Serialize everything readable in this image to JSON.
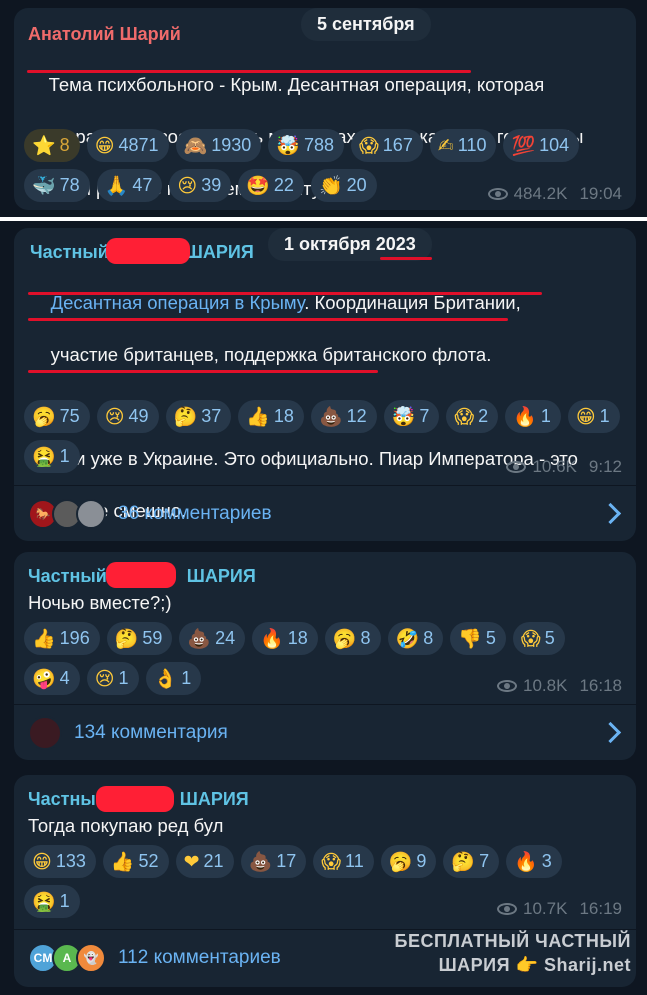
{
  "posts": [
    {
      "author": "Анатолий Шарий",
      "date_pill": "5 сентября",
      "text_line1_a": "Тема психбольного - Крым. Десантная операция",
      "text_line1_b": ", которая",
      "text_line2": "\"поразит дерзостью весь мир\" с заходом в какой-то город. Мы",
      "text_line3": "как и раньше полагаем - в Ялту.",
      "reactions": [
        {
          "emoji": "⭐",
          "count": "8"
        },
        {
          "emoji": "😁",
          "count": "4871"
        },
        {
          "emoji": "🙈",
          "count": "1930"
        },
        {
          "emoji": "🤯",
          "count": "788"
        },
        {
          "emoji": "😱",
          "count": "167"
        },
        {
          "emoji": "✍",
          "count": "110"
        },
        {
          "emoji": "💯",
          "count": "104"
        },
        {
          "emoji": "🐳",
          "count": "78"
        },
        {
          "emoji": "🙏",
          "count": "47"
        },
        {
          "emoji": "😢",
          "count": "39"
        },
        {
          "emoji": "🤩",
          "count": "22"
        },
        {
          "emoji": "👏",
          "count": "20"
        }
      ],
      "views": "484.2K",
      "time": "19:04"
    },
    {
      "author_left": "Частный",
      "author_right": "ШАРИЯ",
      "date_pill": "1 октября 2023",
      "link_text": "Десантная операция в Крыму",
      "text_a": ". Координация Британии,",
      "text_b": "участие британцев, поддержка британского флота.",
      "text_c": "Они уже в Украине. Это официально.",
      "text_d": " Пиар Императора - это",
      "text_e": "уже не смешно.",
      "reactions": [
        {
          "emoji": "🥱",
          "count": "75"
        },
        {
          "emoji": "😢",
          "count": "49"
        },
        {
          "emoji": "🤔",
          "count": "37"
        },
        {
          "emoji": "👍",
          "count": "18"
        },
        {
          "emoji": "💩",
          "count": "12"
        },
        {
          "emoji": "🤯",
          "count": "7"
        },
        {
          "emoji": "😱",
          "count": "2"
        },
        {
          "emoji": "🔥",
          "count": "1"
        },
        {
          "emoji": "😁",
          "count": "1"
        },
        {
          "emoji": "🤮",
          "count": "1"
        }
      ],
      "views": "10.6K",
      "time": "9:12",
      "comments": "36 комментариев"
    },
    {
      "author_left": "Частный",
      "author_right": "ШАРИЯ",
      "text": "Ночью вместе?;)",
      "reactions": [
        {
          "emoji": "👍",
          "count": "196"
        },
        {
          "emoji": "🤔",
          "count": "59"
        },
        {
          "emoji": "💩",
          "count": "24"
        },
        {
          "emoji": "🔥",
          "count": "18"
        },
        {
          "emoji": "🥱",
          "count": "8"
        },
        {
          "emoji": "🤣",
          "count": "8"
        },
        {
          "emoji": "👎",
          "count": "5"
        },
        {
          "emoji": "😱",
          "count": "5"
        },
        {
          "emoji": "🤪",
          "count": "4"
        },
        {
          "emoji": "😢",
          "count": "1"
        },
        {
          "emoji": "👌",
          "count": "1"
        }
      ],
      "views": "10.8K",
      "time": "16:18",
      "comments": "134 комментария"
    },
    {
      "author_left": "Частны",
      "author_right": "ШАРИЯ",
      "text": "Тогда покупаю ред бул",
      "reactions": [
        {
          "emoji": "😁",
          "count": "133"
        },
        {
          "emoji": "👍",
          "count": "52"
        },
        {
          "emoji": "❤",
          "count": "21"
        },
        {
          "emoji": "💩",
          "count": "17"
        },
        {
          "emoji": "😱",
          "count": "11"
        },
        {
          "emoji": "🥱",
          "count": "9"
        },
        {
          "emoji": "🤔",
          "count": "7"
        },
        {
          "emoji": "🔥",
          "count": "3"
        },
        {
          "emoji": "🤮",
          "count": "1"
        }
      ],
      "views": "10.7K",
      "time": "16:19",
      "comments": "112 комментариев",
      "avatar_letters": [
        "CM",
        "A"
      ]
    }
  ],
  "watermark_line1": "БЕСПЛАТНЫЙ ЧАСТНЫЙ",
  "watermark_line2": "ШАРИЯ 👉 Sharij.net",
  "colors": {
    "bubble": "#182533",
    "background": "#0e1621",
    "link": "#6ab3f3",
    "redact": "#ff1f35"
  }
}
